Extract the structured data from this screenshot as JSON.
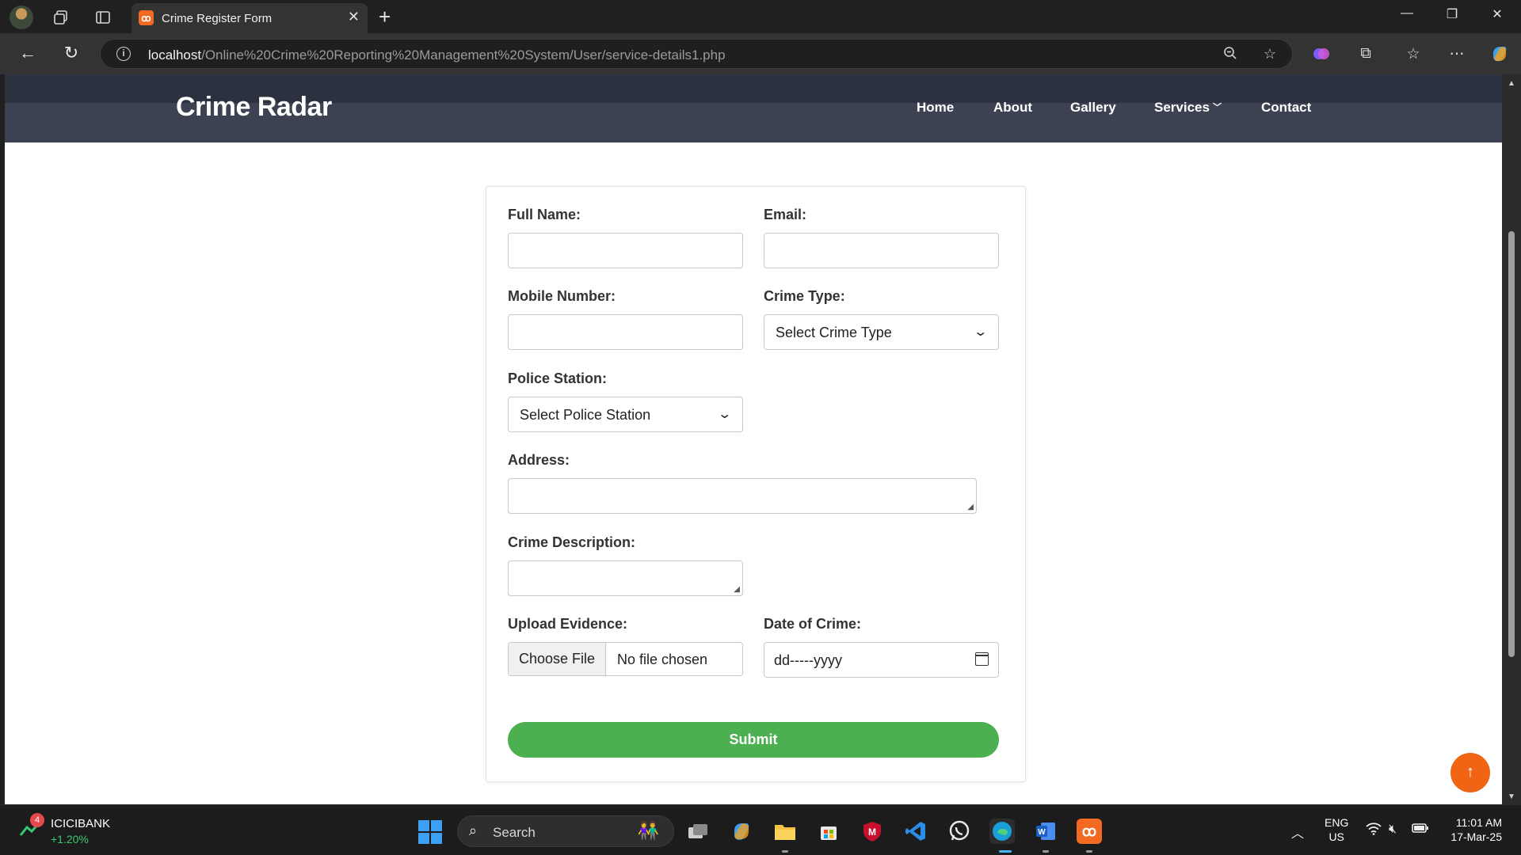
{
  "browser": {
    "tab_title": "Crime Register Form",
    "url_host": "localhost",
    "url_path": "/Online%20Crime%20Reporting%20Management%20System/User/service-details1.php"
  },
  "site": {
    "brand": "Crime Radar",
    "nav": {
      "home": "Home",
      "about": "About",
      "gallery": "Gallery",
      "services": "Services",
      "contact": "Contact"
    }
  },
  "form": {
    "full_name_label": "Full Name:",
    "email_label": "Email:",
    "mobile_label": "Mobile Number:",
    "crime_type_label": "Crime Type:",
    "crime_type_value": "Select Crime Type",
    "police_station_label": "Police Station:",
    "police_station_value": "Select Police Station",
    "address_label": "Address:",
    "description_label": "Crime Description:",
    "evidence_label": "Upload Evidence:",
    "choose_file": "Choose File",
    "no_file": "No file chosen",
    "date_label": "Date of Crime:",
    "date_placeholder": "dd-----yyyy",
    "submit": "Submit"
  },
  "taskbar": {
    "stock_name": "ICICIBANK",
    "stock_change": "+1.20%",
    "stock_badge": "4",
    "search_text": "Search",
    "lang_line1": "ENG",
    "lang_line2": "US",
    "time": "11:01 AM",
    "date": "17-Mar-25"
  },
  "colors": {
    "accent_submit": "#4caf50",
    "scroll_top_button": "#f06414",
    "header_bg": "#3d4252"
  }
}
